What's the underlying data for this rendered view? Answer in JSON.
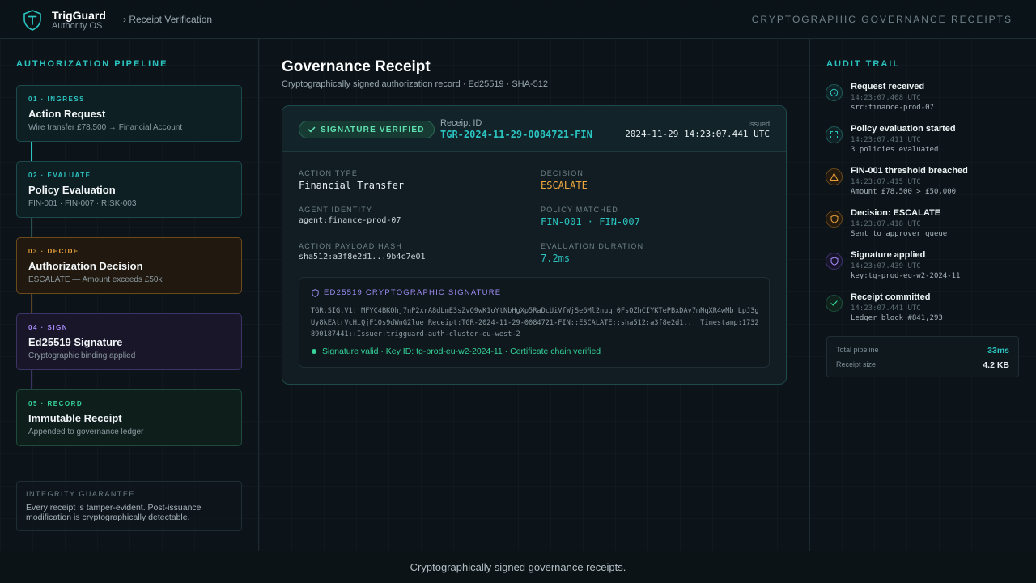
{
  "header": {
    "brand_name": "TrigGuard",
    "brand_sub": "Authority OS",
    "breadcrumb": "› Receipt Verification",
    "tagline": "CRYPTOGRAPHIC GOVERNANCE RECEIPTS",
    "logo_icon": "shield-t-icon"
  },
  "pipeline": {
    "title": "AUTHORIZATION PIPELINE",
    "steps": [
      {
        "num": "01 · INGRESS",
        "title": "Action Request",
        "desc": "Wire transfer £78,500 → Financial Account",
        "color": "#2bc4c0"
      },
      {
        "num": "02 · EVALUATE",
        "title": "Policy Evaluation",
        "desc": "FIN-001 · FIN-007 · RISK-003",
        "color": "#2bc4c0"
      },
      {
        "num": "03 · DECIDE",
        "title": "Authorization Decision",
        "desc": "ESCALATE — Amount exceeds £50k",
        "color": "#e9a23b"
      },
      {
        "num": "04 · SIGN",
        "title": "Ed25519 Signature",
        "desc": "Cryptographic binding applied",
        "color": "#a78bfa"
      },
      {
        "num": "05 · RECORD",
        "title": "Immutable Receipt",
        "desc": "Appended to governance ledger",
        "color": "#34d399"
      }
    ],
    "integrity_title": "INTEGRITY GUARANTEE",
    "integrity_text": "Every receipt is tamper-evident. Post-issuance modification is cryptographically detectable."
  },
  "main": {
    "title": "Governance Receipt",
    "subtitle": "Cryptographically signed authorization record · Ed25519 · SHA-512"
  },
  "receipt": {
    "verified_label": "SIGNATURE VERIFIED",
    "id_label": "Receipt ID",
    "id": "TGR-2024-11-29-0084721-FIN",
    "issued_label": "Issued",
    "issued": "2024-11-29 14:23:07.441 UTC",
    "fields": {
      "action_type_label": "ACTION TYPE",
      "action_type": "Financial Transfer",
      "decision_label": "DECISION",
      "decision": "ESCALATE",
      "agent_label": "AGENT IDENTITY",
      "agent": "agent:finance-prod-07",
      "policy_label": "POLICY MATCHED",
      "policy": "FIN-001 · FIN-007",
      "hash_label": "ACTION PAYLOAD HASH",
      "hash": "sha512:a3f8e2d1...9b4c7e01",
      "duration_label": "EVALUATION DURATION",
      "duration": "7.2ms"
    },
    "signature": {
      "title": "ED25519 CRYPTOGRAPHIC SIGNATURE",
      "text": "TGR.SIG.V1: MFYC4BKQhj7nP2xrA8dLmE3sZvQ9wK1oYtNbHgXp5RaDcUiVfWjSe6Ml2nuq 0FsOZhCIYKTePBxDAv7mNqXR4wMb LpJ3gUy8kEAtrVcHiQjF1Os9dWnG2lue Receipt:TGR-2024-11-29-0084721-FIN::ESCALATE::sha512:a3f8e2d1... Timestamp:1732890187441::Issuer:trigguard-auth-cluster-eu-west-2",
      "status": "Signature valid · Key ID: tg-prod-eu-w2-2024-11 · Certificate chain verified"
    }
  },
  "audit": {
    "title": "AUDIT TRAIL",
    "items": [
      {
        "title": "Request received",
        "time": "14:23:07.408 UTC",
        "detail": "src:finance-prod-07",
        "icon": "clock-icon"
      },
      {
        "title": "Policy evaluation started",
        "time": "14:23:07.411 UTC",
        "detail": "3 policies evaluated",
        "icon": "scan-icon"
      },
      {
        "title": "FIN-001 threshold breached",
        "time": "14:23:07.415 UTC",
        "detail": "Amount £78,500 > £50,000",
        "icon": "warning-icon"
      },
      {
        "title": "Decision: ESCALATE",
        "time": "14:23:07.418 UTC",
        "detail": "Sent to approver queue",
        "icon": "shield-icon"
      },
      {
        "title": "Signature applied",
        "time": "14:23:07.439 UTC",
        "detail": "key:tg-prod-eu-w2-2024-11",
        "icon": "shield-icon"
      },
      {
        "title": "Receipt committed",
        "time": "14:23:07.441 UTC",
        "detail": "Ledger block #841,293",
        "icon": "check-icon"
      }
    ],
    "stats": [
      {
        "label": "Total pipeline",
        "value": "33ms",
        "color": "#2bc4c0"
      },
      {
        "label": "Receipt size",
        "value": "4.2 KB",
        "color": "#e6edf0"
      }
    ]
  },
  "footer": {
    "text": "Cryptographically signed governance receipts."
  }
}
